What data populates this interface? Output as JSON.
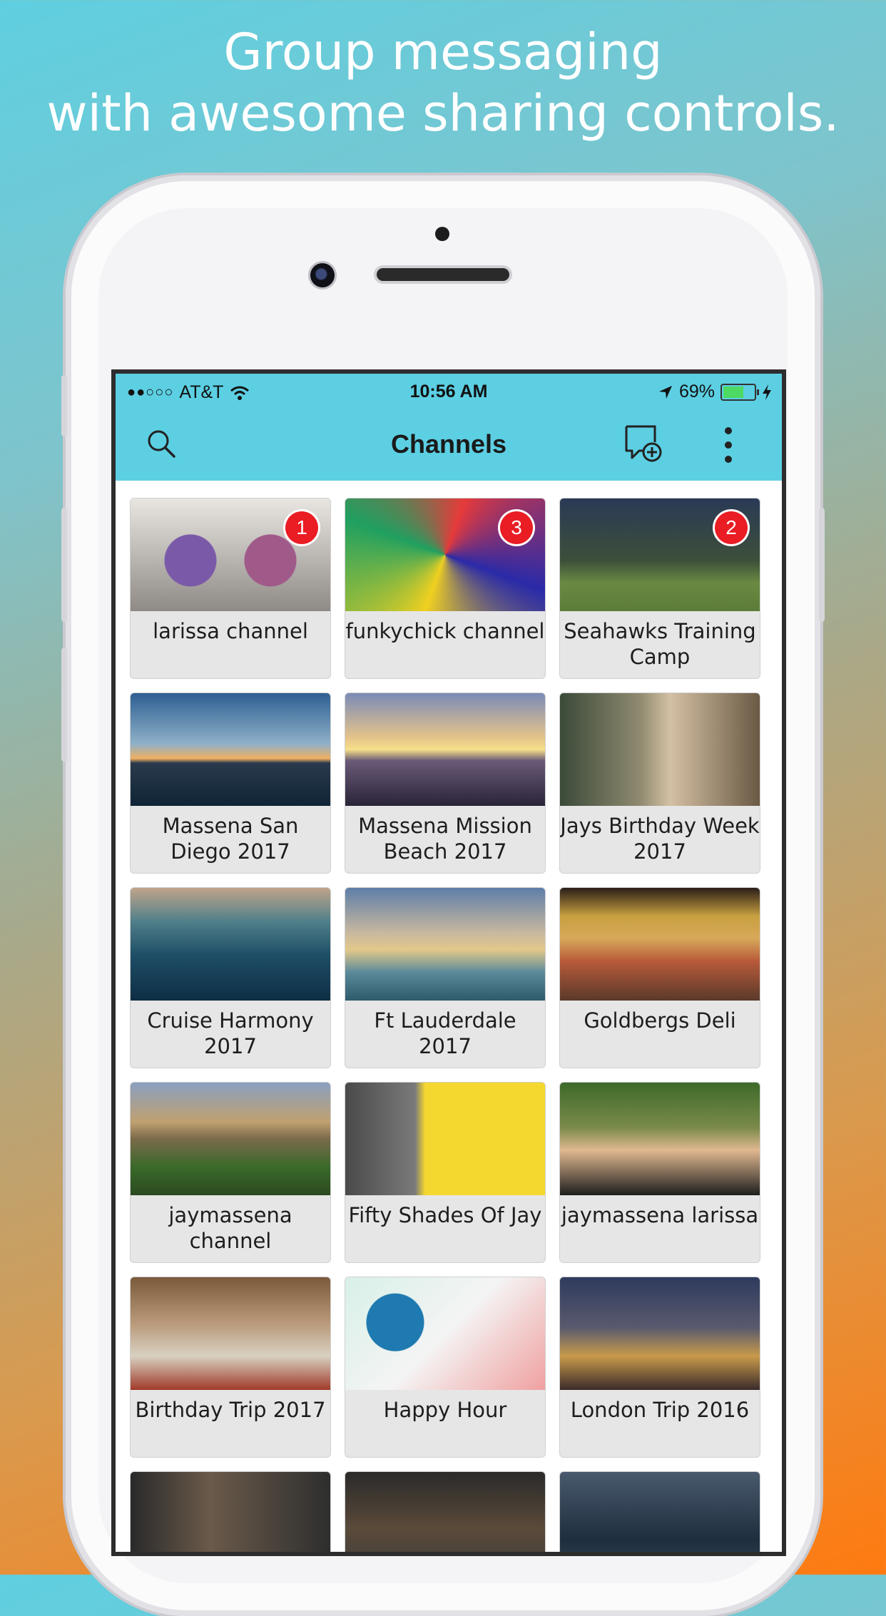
{
  "headline": {
    "line1": "Group messaging",
    "line2": "with awesome sharing controls."
  },
  "status_bar": {
    "carrier": "AT&T",
    "time": "10:56 AM",
    "battery": "69%",
    "battery_level": 0.69
  },
  "nav": {
    "title": "Channels",
    "icons": [
      "search-icon",
      "new-chat-icon",
      "more-vertical-icon"
    ]
  },
  "channels": [
    {
      "label": "larissa channel",
      "badge": "1"
    },
    {
      "label": "funkychick channel",
      "badge": "3"
    },
    {
      "label": "Seahawks Training Camp",
      "badge": "2"
    },
    {
      "label": "Massena San Diego 2017",
      "badge": null
    },
    {
      "label": "Massena Mission Beach 2017",
      "badge": null
    },
    {
      "label": "Jays Birthday Week 2017",
      "badge": null
    },
    {
      "label": "Cruise Harmony 2017",
      "badge": null
    },
    {
      "label": "Ft Lauderdale 2017",
      "badge": null
    },
    {
      "label": "Goldbergs Deli",
      "badge": null
    },
    {
      "label": "jaymassena channel",
      "badge": null
    },
    {
      "label": "Fifty Shades Of Jay",
      "badge": null
    },
    {
      "label": "jaymassena larissa",
      "badge": null
    },
    {
      "label": "Birthday Trip 2017",
      "badge": null
    },
    {
      "label": "Happy Hour",
      "badge": null
    },
    {
      "label": "London Trip 2016",
      "badge": null
    },
    {
      "label": "",
      "badge": null
    },
    {
      "label": "",
      "badge": null
    },
    {
      "label": "",
      "badge": null
    }
  ],
  "colors": {
    "nav_bar": "#5ccfe3",
    "badge": "#ea1c24",
    "tile_background": "#e6e6e6"
  }
}
